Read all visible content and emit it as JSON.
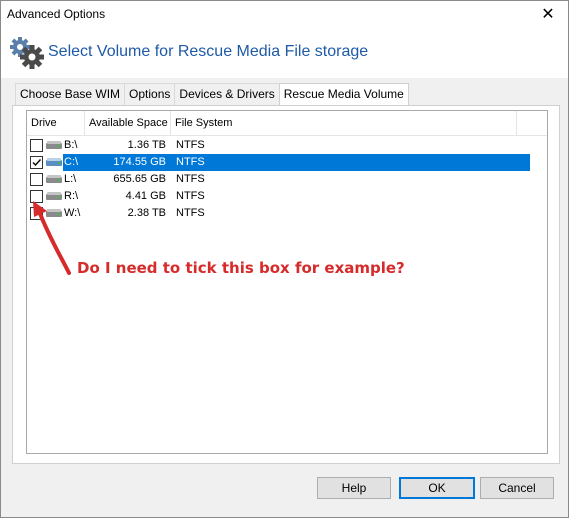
{
  "window": {
    "title": "Advanced Options",
    "close_glyph": "✕"
  },
  "header": {
    "title": "Select Volume for Rescue Media File storage",
    "icon": "gears-icon"
  },
  "tabs": [
    {
      "label": "Choose Base WIM"
    },
    {
      "label": "Options"
    },
    {
      "label": "Devices & Drivers"
    },
    {
      "label": "Rescue Media Volume",
      "active": true
    }
  ],
  "table": {
    "columns": [
      "Drive",
      "Available Space",
      "File System"
    ],
    "rows": [
      {
        "drive": "B:\\",
        "space": "1.36 TB",
        "fs": "NTFS",
        "checked": false,
        "selected": false
      },
      {
        "drive": "C:\\",
        "space": "174.55 GB",
        "fs": "NTFS",
        "checked": true,
        "selected": true
      },
      {
        "drive": "L:\\",
        "space": "655.65 GB",
        "fs": "NTFS",
        "checked": false,
        "selected": false
      },
      {
        "drive": "R:\\",
        "space": "4.41 GB",
        "fs": "NTFS",
        "checked": false,
        "selected": false
      },
      {
        "drive": "W:\\",
        "space": "2.38 TB",
        "fs": "NTFS",
        "checked": false,
        "selected": false
      }
    ]
  },
  "annotation": {
    "text": "Do I need to tick this box for example?",
    "color": "#d62b2b"
  },
  "buttons": {
    "help": "Help",
    "ok": "OK",
    "cancel": "Cancel"
  },
  "colors": {
    "accent": "#0078d7",
    "header_title": "#1f5aa8"
  }
}
